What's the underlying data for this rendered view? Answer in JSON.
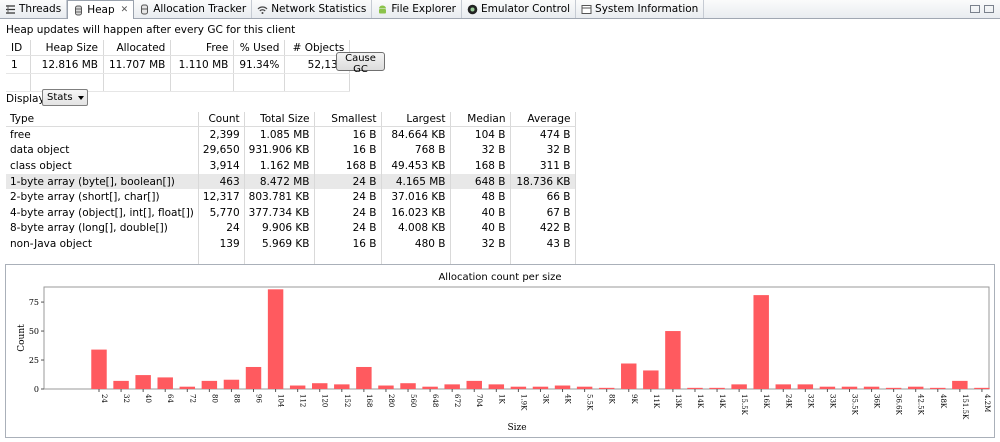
{
  "tabs": [
    {
      "label": "Threads",
      "icon": "threads-icon",
      "active": false
    },
    {
      "label": "Heap",
      "icon": "heap-icon",
      "active": true
    },
    {
      "label": "Allocation Tracker",
      "icon": "allocation-icon",
      "active": false
    },
    {
      "label": "Network Statistics",
      "icon": "network-icon",
      "active": false
    },
    {
      "label": "File Explorer",
      "icon": "android-icon",
      "active": false
    },
    {
      "label": "Emulator Control",
      "icon": "emulator-icon",
      "active": false
    },
    {
      "label": "System Information",
      "icon": "sysinfo-icon",
      "active": false
    }
  ],
  "heap_info": "Heap updates will happen after every GC for this client",
  "summary": {
    "headers": [
      "ID",
      "Heap Size",
      "Allocated",
      "Free",
      "% Used",
      "# Objects"
    ],
    "rows": [
      [
        "1",
        "12.816 MB",
        "11.707 MB",
        "1.110 MB",
        "91.34%",
        "52,138"
      ]
    ]
  },
  "cause_gc_label": "Cause GC",
  "display": {
    "label": "Display:",
    "selected": "Stats"
  },
  "stats": {
    "headers": [
      "Type",
      "Count",
      "Total Size",
      "Smallest",
      "Largest",
      "Median",
      "Average"
    ],
    "rows": [
      [
        "free",
        "2,399",
        "1.085 MB",
        "16 B",
        "84.664 KB",
        "104 B",
        "474 B"
      ],
      [
        "data object",
        "29,650",
        "931.906 KB",
        "16 B",
        "768 B",
        "32 B",
        "32 B"
      ],
      [
        "class object",
        "3,914",
        "1.162 MB",
        "168 B",
        "49.453 KB",
        "168 B",
        "311 B"
      ],
      [
        "1-byte array (byte[], boolean[])",
        "463",
        "8.472 MB",
        "24 B",
        "4.165 MB",
        "648 B",
        "18.736 KB"
      ],
      [
        "2-byte array (short[], char[])",
        "12,317",
        "803.781 KB",
        "24 B",
        "37.016 KB",
        "48 B",
        "66 B"
      ],
      [
        "4-byte array (object[], int[], float[])",
        "5,770",
        "377.734 KB",
        "24 B",
        "16.023 KB",
        "40 B",
        "67 B"
      ],
      [
        "8-byte array (long[], double[])",
        "24",
        "9.906 KB",
        "24 B",
        "4.008 KB",
        "40 B",
        "422 B"
      ],
      [
        "non-Java object",
        "139",
        "5.969 KB",
        "16 B",
        "480 B",
        "32 B",
        "43 B"
      ]
    ],
    "selected_row": 3
  },
  "chart_data": {
    "type": "bar",
    "title": "Allocation count per size",
    "xlabel": "Size",
    "ylabel": "Count",
    "ylim": [
      0,
      88
    ],
    "yticks": [
      "0",
      "25",
      "50",
      "75"
    ],
    "grid": false,
    "legend": "none",
    "bar_color": "#ff5a5f",
    "categories": [
      "24",
      "32",
      "40",
      "64",
      "72",
      "80",
      "88",
      "96",
      "104",
      "112",
      "120",
      "152",
      "168",
      "280",
      "560",
      "648",
      "672",
      "704",
      "1K",
      "1.9K",
      "3K",
      "4K",
      "5.5K",
      "8K",
      "9K",
      "11K",
      "13K",
      "14K",
      "14K",
      "15.5K",
      "16K",
      "24K",
      "32K",
      "33K",
      "35.5K",
      "36K",
      "36.6K",
      "42.5K",
      "48K",
      "151.5K",
      "4.2M"
    ],
    "values": [
      34,
      7,
      12,
      10,
      2,
      7,
      8,
      19,
      86,
      3,
      5,
      4,
      19,
      3,
      5,
      2,
      4,
      7,
      4,
      2,
      2,
      3,
      2,
      1,
      22,
      16,
      50,
      1,
      1,
      4,
      81,
      4,
      4,
      2,
      2,
      2,
      1,
      2,
      1,
      7,
      1
    ]
  }
}
